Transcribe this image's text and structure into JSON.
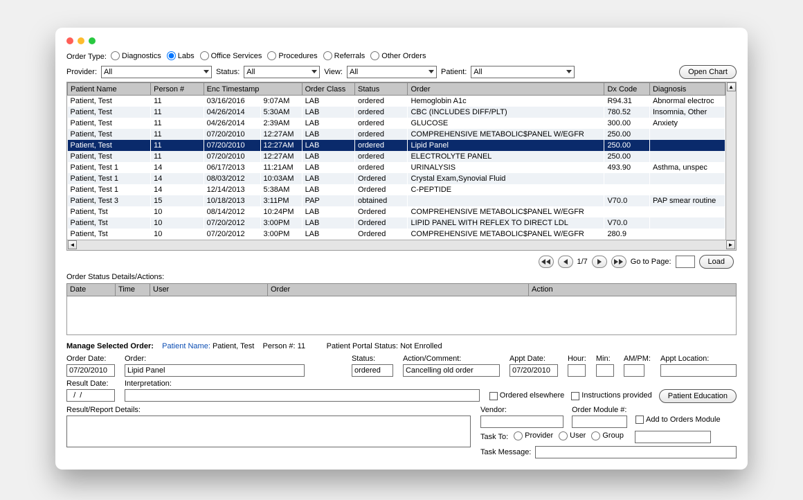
{
  "order_type": {
    "label": "Order Type:",
    "options": [
      "Diagnostics",
      "Labs",
      "Office Services",
      "Procedures",
      "Referrals",
      "Other Orders"
    ],
    "selected_index": 1
  },
  "filters": {
    "provider_label": "Provider:",
    "provider_value": "All",
    "status_label": "Status:",
    "status_value": "All",
    "view_label": "View:",
    "view_value": "All",
    "patient_label": "Patient:",
    "patient_value": "All",
    "open_chart": "Open Chart"
  },
  "columns": [
    "Patient Name",
    "Person #",
    "Enc Timestamp",
    "Order Class",
    "Status",
    "Order",
    "Dx Code",
    "Diagnosis"
  ],
  "rows": [
    {
      "patient": "Patient, Test",
      "person": "11",
      "date": "03/16/2016",
      "time": "9:07AM",
      "class": "LAB",
      "status": "ordered",
      "order": "Hemoglobin A1c",
      "dx": "R94.31",
      "diag": "Abnormal electroc"
    },
    {
      "patient": "Patient, Test",
      "person": "11",
      "date": "04/26/2014",
      "time": "5:30AM",
      "class": "LAB",
      "status": "ordered",
      "order": "CBC (INCLUDES DIFF/PLT)",
      "dx": "780.52",
      "diag": "Insomnia, Other"
    },
    {
      "patient": "Patient, Test",
      "person": "11",
      "date": "04/26/2014",
      "time": "2:39AM",
      "class": "LAB",
      "status": "ordered",
      "order": "GLUCOSE",
      "dx": "300.00",
      "diag": "Anxiety"
    },
    {
      "patient": "Patient, Test",
      "person": "11",
      "date": "07/20/2010",
      "time": "12:27AM",
      "class": "LAB",
      "status": "ordered",
      "order": "COMPREHENSIVE METABOLIC$PANEL W/EGFR",
      "dx": "250.00",
      "diag": ""
    },
    {
      "patient": "Patient, Test",
      "person": "11",
      "date": "07/20/2010",
      "time": "12:27AM",
      "class": "LAB",
      "status": "ordered",
      "order": "Lipid Panel",
      "dx": "250.00",
      "diag": "",
      "selected": true
    },
    {
      "patient": "Patient, Test",
      "person": "11",
      "date": "07/20/2010",
      "time": "12:27AM",
      "class": "LAB",
      "status": "ordered",
      "order": "ELECTROLYTE PANEL",
      "dx": "250.00",
      "diag": ""
    },
    {
      "patient": "Patient, Test 1",
      "person": "14",
      "date": "06/17/2013",
      "time": "11:21AM",
      "class": "LAB",
      "status": "ordered",
      "order": "URINALYSIS",
      "dx": "493.90",
      "diag": "Asthma, unspec"
    },
    {
      "patient": "Patient, Test 1",
      "person": "14",
      "date": "08/03/2012",
      "time": "10:03AM",
      "class": "LAB",
      "status": "Ordered",
      "order": "Crystal Exam,Synovial Fluid",
      "dx": "",
      "diag": ""
    },
    {
      "patient": "Patient, Test 1",
      "person": "14",
      "date": "12/14/2013",
      "time": "5:38AM",
      "class": "LAB",
      "status": "Ordered",
      "order": "C-PEPTIDE",
      "dx": "",
      "diag": ""
    },
    {
      "patient": "Patient, Test 3",
      "person": "15",
      "date": "10/18/2013",
      "time": "3:11PM",
      "class": "PAP",
      "status": "obtained",
      "order": "",
      "dx": "V70.0",
      "diag": "PAP smear routine"
    },
    {
      "patient": "Patient, Tst",
      "person": "10",
      "date": "08/14/2012",
      "time": "10:24PM",
      "class": "LAB",
      "status": "Ordered",
      "order": "COMPREHENSIVE METABOLIC$PANEL W/EGFR",
      "dx": "",
      "diag": ""
    },
    {
      "patient": "Patient, Tst",
      "person": "10",
      "date": "07/20/2012",
      "time": "3:00PM",
      "class": "LAB",
      "status": "Ordered",
      "order": "LIPID PANEL WITH REFLEX TO DIRECT LDL",
      "dx": "V70.0",
      "diag": ""
    },
    {
      "patient": "Patient, Tst",
      "person": "10",
      "date": "07/20/2012",
      "time": "3:00PM",
      "class": "LAB",
      "status": "Ordered",
      "order": "COMPREHENSIVE METABOLIC$PANEL W/EGFR",
      "dx": "280.9",
      "diag": ""
    }
  ],
  "pager": {
    "page_text": "1/7",
    "goto_label": "Go to Page:",
    "load": "Load"
  },
  "details": {
    "title": "Order Status Details/Actions:",
    "columns": [
      "Date",
      "Time",
      "User",
      "Order",
      "Action"
    ]
  },
  "selected_order": {
    "title": "Manage Selected Order:",
    "pn_label": "Patient Name:",
    "pn_value": "Patient, Test",
    "person_label": "Person #:",
    "person_value": "11",
    "portal_label": "Patient Portal Status:",
    "portal_value": "Not Enrolled"
  },
  "form": {
    "order_date_label": "Order Date:",
    "order_date": "07/20/2010",
    "order_label": "Order:",
    "order_value": "Lipid Panel",
    "status_label": "Status:",
    "status_value": "ordered",
    "action_label": "Action/Comment:",
    "action_value": "Cancelling old order",
    "appt_date_label": "Appt Date:",
    "appt_date": "07/20/2010",
    "hour_label": "Hour:",
    "min_label": "Min:",
    "ampm_label": "AM/PM:",
    "appt_loc_label": "Appt Location:",
    "result_date_label": "Result Date:",
    "result_date": "  /  /",
    "interp_label": "Interpretation:",
    "result_details_label": "Result/Report Details:",
    "ordered_elsewhere": "Ordered elsewhere",
    "instructions_provided": "Instructions provided",
    "patient_education": "Patient Education",
    "vendor_label": "Vendor:",
    "order_module_label": "Order Module #:",
    "add_to_orders": "Add to Orders Module",
    "task_to_label": "Task To:",
    "task_opts": [
      "Provider",
      "User",
      "Group"
    ],
    "task_message_label": "Task Message:"
  }
}
